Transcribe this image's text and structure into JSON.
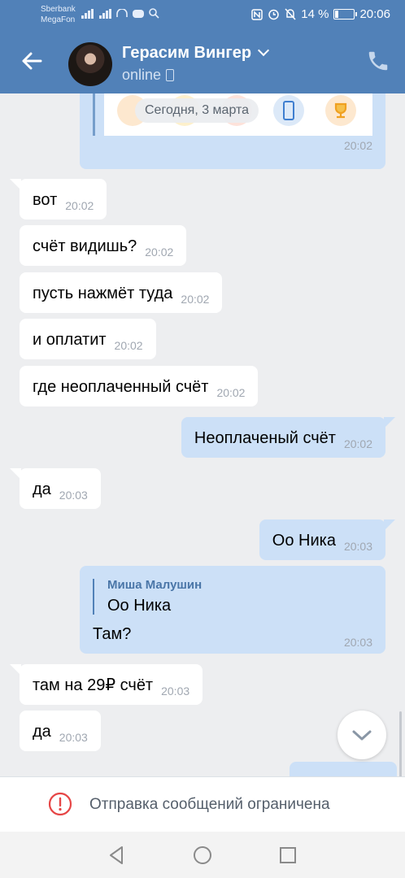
{
  "status_bar": {
    "carrier_1": "Sberbank",
    "carrier_2": "MegaFon",
    "battery_text": "14 %",
    "battery_level": 0.14,
    "clock": "20:06"
  },
  "header": {
    "contact_name": "Герасим Вингер",
    "status": "online",
    "icons": [
      "back-arrow-icon",
      "chevron-down-icon",
      "phone-device-icon",
      "call-icon"
    ]
  },
  "date_separator": "Сегодня, 3 марта",
  "top_card": {
    "time": "20:02"
  },
  "messages": [
    {
      "text": "вот",
      "time": "20:02",
      "direction": "in"
    },
    {
      "text": "счёт видишь?",
      "time": "20:02",
      "direction": "in"
    },
    {
      "text": "пусть нажмёт туда",
      "time": "20:02",
      "direction": "in"
    },
    {
      "text": "и оплатит",
      "time": "20:02",
      "direction": "in"
    },
    {
      "text": "где неоплаченный счёт",
      "time": "20:02",
      "direction": "in"
    },
    {
      "text": "Неоплаченый счёт",
      "time": "20:02",
      "direction": "out"
    },
    {
      "text": "да",
      "time": "20:03",
      "direction": "in"
    },
    {
      "text": "Оо Ника",
      "time": "20:03",
      "direction": "out"
    },
    {
      "text": "там на 29₽ счёт",
      "time": "20:03",
      "direction": "in"
    },
    {
      "text": "да",
      "time": "20:03",
      "direction": "in"
    }
  ],
  "reply": {
    "author": "Миша Малушин",
    "quote": "Оо Ника",
    "text": "Там?",
    "time": "20:03"
  },
  "restriction": {
    "text": "Отправка сообщений ограничена"
  },
  "colors": {
    "header": "#5181b8",
    "background": "#edeef0",
    "outgoing_bubble": "#cce0f7",
    "incoming_bubble": "#ffffff",
    "alert_red": "#e64646"
  }
}
